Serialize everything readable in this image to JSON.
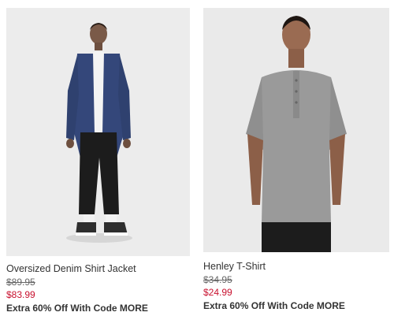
{
  "products": [
    {
      "name": "Oversized Denim Shirt Jacket",
      "original_price": "$89.95",
      "sale_price": "$83.99",
      "promo": "Extra 60% Off With Code MORE",
      "image": "model-in-denim-shirt-jacket-photo"
    },
    {
      "name": "Henley T-Shirt",
      "original_price": "$34.95",
      "sale_price": "$24.99",
      "promo": "Extra 60% Off With Code MORE",
      "image": "model-in-grey-henley-tshirt-photo"
    }
  ],
  "colors": {
    "sale_price": "#c8102e",
    "text": "#333333",
    "photo_background": "#ececec"
  }
}
